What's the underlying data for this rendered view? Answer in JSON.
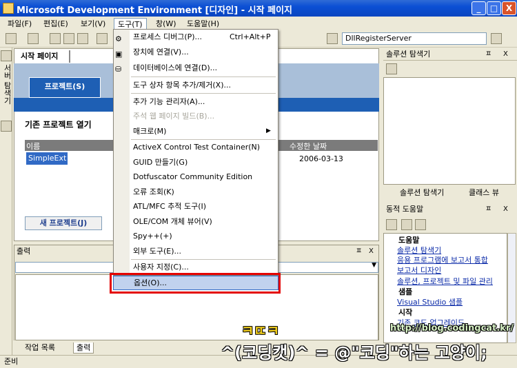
{
  "window": {
    "title": "Microsoft Development Environment [디자인] - 시작 페이지",
    "buttons": [
      "_",
      "□",
      "X"
    ]
  },
  "menubar": [
    "파일(F)",
    "편집(E)",
    "보기(V)",
    "도구(T)",
    "창(W)",
    "도움말(H)"
  ],
  "toolbar": {
    "dropdown_value": "DllRegisterServer"
  },
  "side_tool": {
    "server_explorer": "서버 탐색기"
  },
  "start_page": {
    "tab": "시작 페이지",
    "projects_tab": "프로젝트(S)",
    "heading": "기존 프로젝트 열기",
    "columns": [
      "이름",
      "수정한 날짜"
    ],
    "rows": [
      {
        "name": "SimpleExt",
        "date": "2006-03-13"
      }
    ],
    "new_project_button": "새 프로젝트(J)"
  },
  "output": {
    "title": "출력",
    "pin": "ㅍ",
    "close": "X"
  },
  "bottom_tabs": [
    "작업 목록",
    "출력"
  ],
  "status": {
    "text": "준비"
  },
  "solution_explorer": {
    "title": "솔루션 탐색기",
    "pin": "ㅍ",
    "close": "X",
    "tabs": [
      "솔루션 탐색기",
      "클래스 뷰"
    ]
  },
  "dynamic_help": {
    "title": "동적 도움말",
    "sections": [
      {
        "title": "도움말",
        "links": [
          "솔루션 탐색기",
          "응용 프로그램에 보고서 통합",
          "보고서 디자인",
          "솔루션, 프로젝트 및 파일 관리"
        ]
      },
      {
        "title": "샘플",
        "links": [
          "Visual Studio 샘플"
        ]
      },
      {
        "title": "시작",
        "links": [
          "기존 코드 업그레이드"
        ]
      }
    ]
  },
  "tools_menu": {
    "items": [
      {
        "label": "프로세스 디버그(P)...",
        "shortcut": "Ctrl+Alt+P"
      },
      {
        "label": "장치에 연결(V)..."
      },
      {
        "label": "데이터베이스에 연결(D)..."
      },
      {
        "label": "도구 상자 항목 추가/제거(X)..."
      },
      {
        "label": "추가 기능 관리자(A)..."
      },
      {
        "label": "주석 웹 페이지 빌드(B)...",
        "disabled": true
      },
      {
        "label": "매크로(M)",
        "submenu": "▶"
      },
      {
        "label": "ActiveX Control Test Container(N)"
      },
      {
        "label": "GUID 만들기(G)"
      },
      {
        "label": "Dotfuscator Community Edition"
      },
      {
        "label": "오류 조회(K)"
      },
      {
        "label": "ATL/MFC 추적 도구(I)"
      },
      {
        "label": "OLE/COM 개체 뷰어(V)"
      },
      {
        "label": "Spy++(+)"
      },
      {
        "label": "외부 도구(E)..."
      },
      {
        "label": "사용자 지정(C)..."
      },
      {
        "label": "옵션(O)..."
      }
    ]
  },
  "watermark": {
    "top": "ㅋㄸㅋ",
    "main": "^(코딩캣)^ = @\"코딩\"하는 고양이;",
    "url": "http://blog.codingcat.kr/"
  }
}
